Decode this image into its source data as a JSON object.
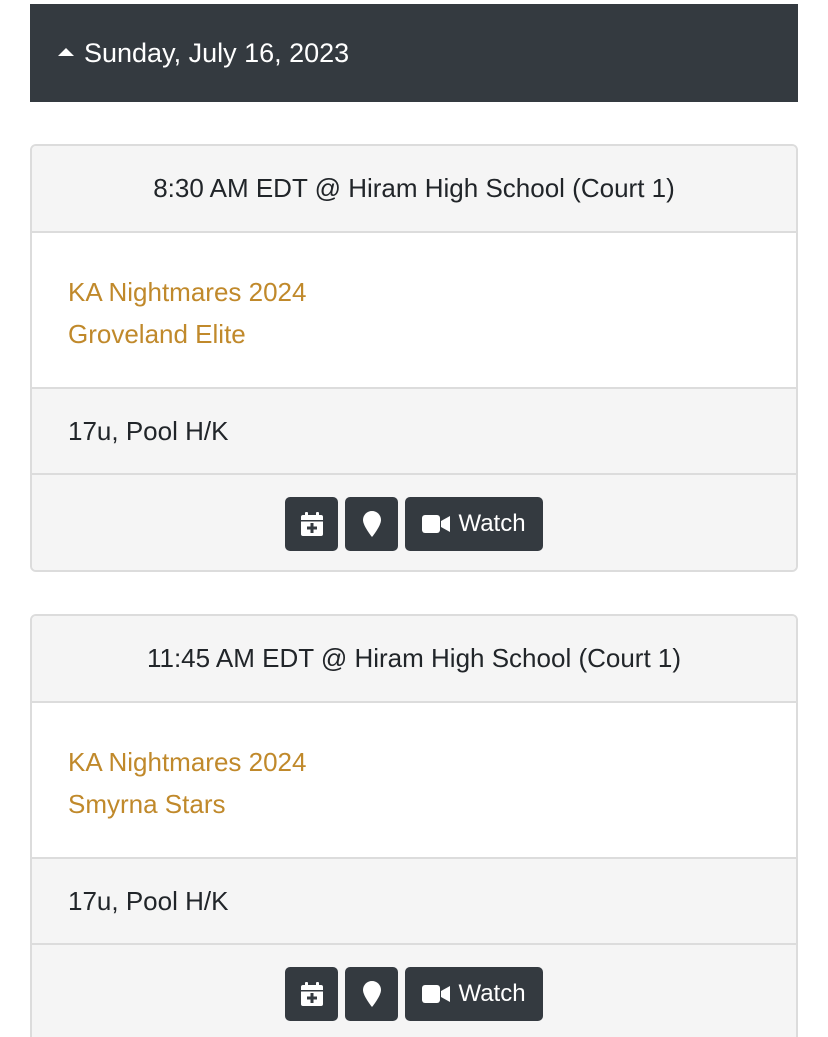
{
  "header": {
    "date": "Sunday, July 16, 2023",
    "icon": "caret-up-icon"
  },
  "games": [
    {
      "time_location": "8:30 AM EDT @ Hiram High School (Court 1)",
      "teams": [
        "KA Nightmares 2024",
        "Groveland Elite"
      ],
      "division": "17u, Pool H/K",
      "actions": {
        "calendar_icon": "calendar-plus-icon",
        "map_icon": "map-marker-icon",
        "watch_label": "Watch",
        "watch_icon": "video-camera-icon"
      }
    },
    {
      "time_location": "11:45 AM EDT @ Hiram High School (Court 1)",
      "teams": [
        "KA Nightmares 2024",
        "Smyrna Stars"
      ],
      "division": "17u, Pool H/K",
      "actions": {
        "calendar_icon": "calendar-plus-icon",
        "map_icon": "map-marker-icon",
        "watch_label": "Watch",
        "watch_icon": "video-camera-icon"
      }
    }
  ],
  "colors": {
    "header_bg": "#343a40",
    "team_link": "#c0892b",
    "card_band": "#f5f5f5",
    "button_bg": "#343a40"
  }
}
